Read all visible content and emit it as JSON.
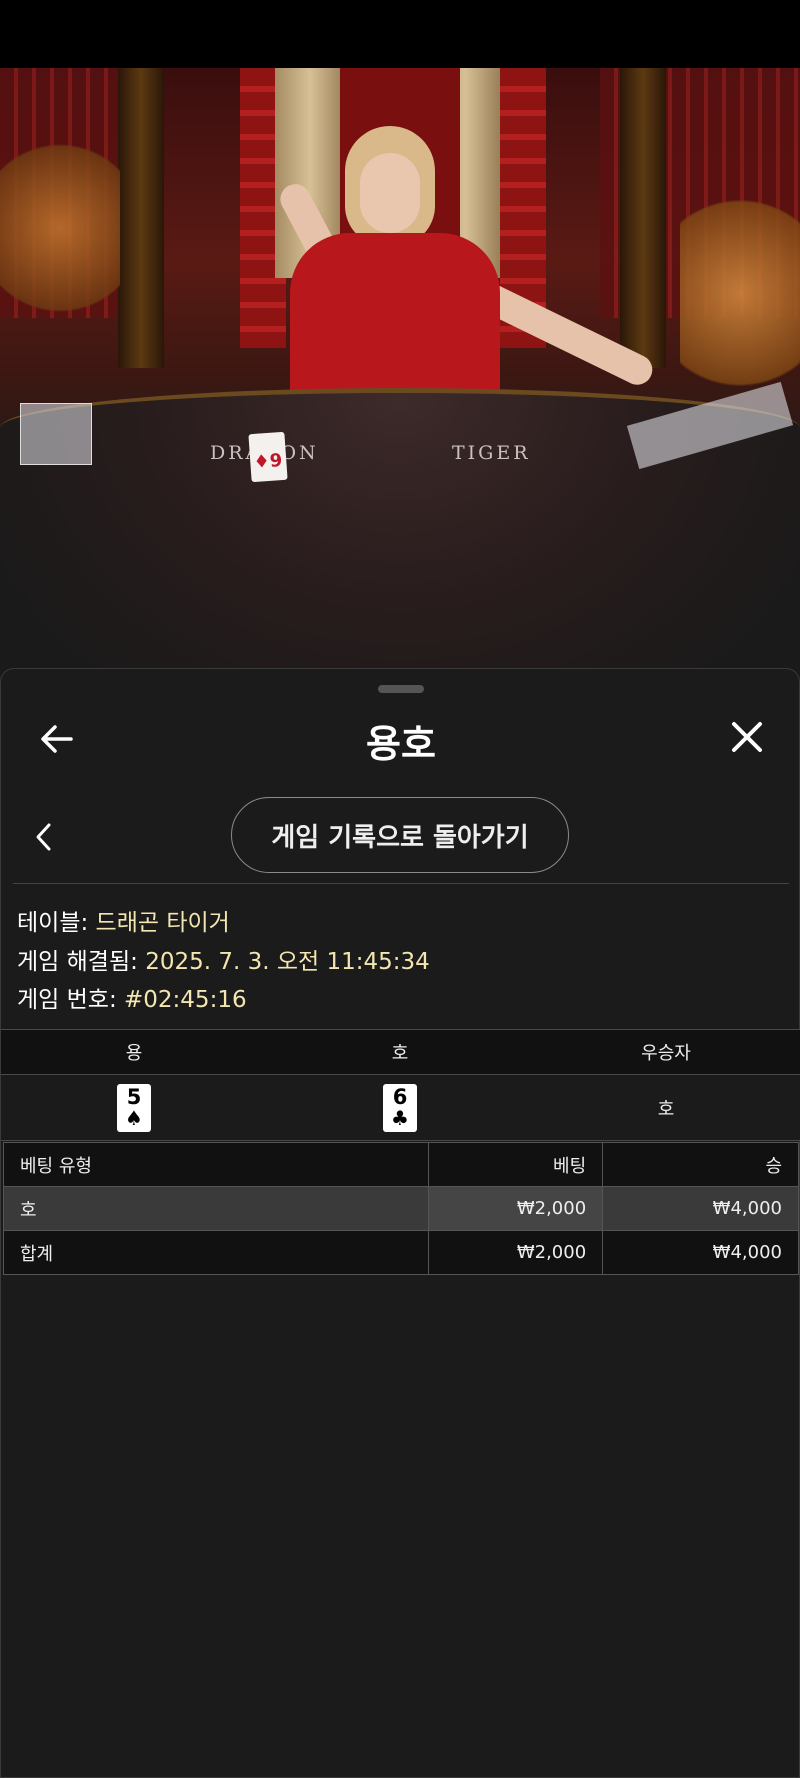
{
  "video": {
    "table_labels": {
      "dragon": "DRAGON",
      "tiger": "TIGER"
    },
    "table_card": {
      "rank": "9",
      "suit": "♦"
    }
  },
  "header": {
    "title": "용호"
  },
  "nav": {
    "history_button_label": "게임 기록으로 돌아가기"
  },
  "info": {
    "table_label": "테이블:",
    "table_value": "드래곤 타이거",
    "resolved_label": "게임 해결됨:",
    "resolved_value": "2025. 7. 3. 오전 11:45:34",
    "number_label": "게임 번호:",
    "number_value": "#02:45:16"
  },
  "result": {
    "headers": [
      "용",
      "호",
      "우승자"
    ],
    "dragon_card": {
      "rank": "5",
      "suit": "♠"
    },
    "tiger_card": {
      "rank": "6",
      "suit": "♣"
    },
    "winner": "호"
  },
  "bets": {
    "headers": [
      "베팅 유형",
      "베팅",
      "승"
    ],
    "rows": [
      {
        "type": "호",
        "bet": "₩2,000",
        "win": "₩4,000"
      }
    ],
    "total": {
      "type": "합계",
      "bet": "₩2,000",
      "win": "₩4,000"
    }
  },
  "colors": {
    "info_value": "#f3e6b0",
    "panel_bg": "#1b1b1b",
    "table_header_bg": "#111111"
  }
}
